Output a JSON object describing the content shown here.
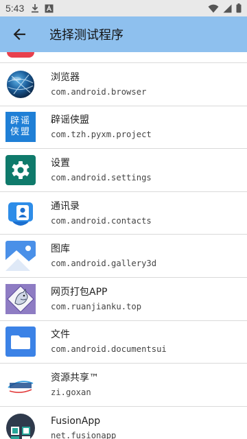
{
  "status_bar": {
    "time": "5:43"
  },
  "app_bar": {
    "title": "选择测试程序"
  },
  "apps": [
    {
      "name": "浏览器",
      "package": "com.android.browser",
      "icon": "browser-globe-icon"
    },
    {
      "name": "辟谣侠盟",
      "package": "com.tzh.pyxm.project",
      "icon": "pyxm-logo-icon",
      "icon_text": [
        "辟谣",
        "侠盟"
      ]
    },
    {
      "name": "设置",
      "package": "com.android.settings",
      "icon": "settings-gear-icon"
    },
    {
      "name": "通讯录",
      "package": "com.android.contacts",
      "icon": "contacts-icon"
    },
    {
      "name": "图库",
      "package": "com.android.gallery3d",
      "icon": "gallery-icon"
    },
    {
      "name": "网页打包APP",
      "package": "com.ruanjianku.top",
      "icon": "webpack-app-icon"
    },
    {
      "name": "文件",
      "package": "com.android.documentsui",
      "icon": "folder-icon"
    },
    {
      "name": "资源共享™",
      "package": "zi.goxan",
      "icon": "resource-share-icon"
    },
    {
      "name": "FusionApp",
      "package": "net.fusionapp",
      "icon": "fusionapp-icon"
    }
  ],
  "colors": {
    "app_bar": "#8ec0ee",
    "status_bar": "#e9e9e9",
    "divider": "#d9d9d9"
  }
}
